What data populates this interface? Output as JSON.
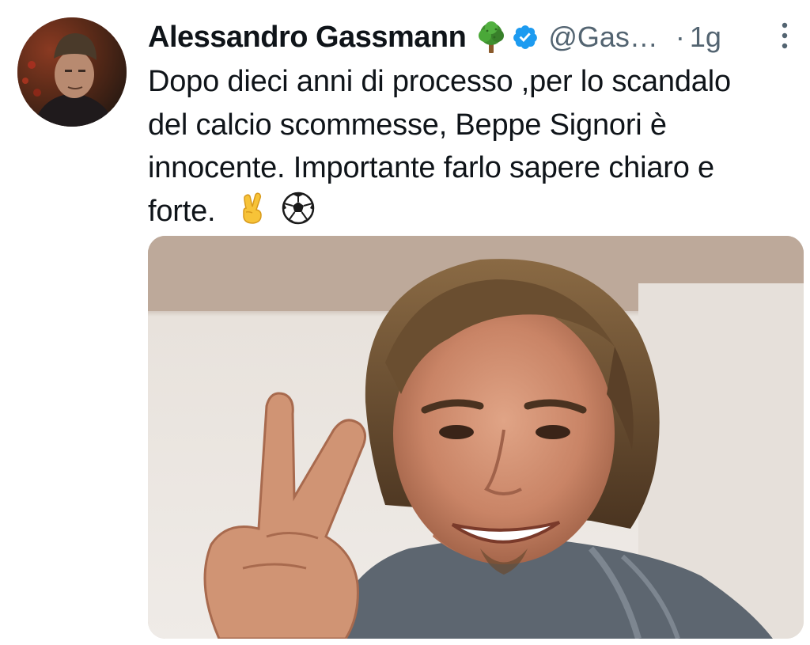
{
  "tweet": {
    "author_name": "Alessandro Gassmann",
    "handle": "@Gas…",
    "separator": "·",
    "time": "1g",
    "text_lines": [
      "Dopo dieci anni di processo ,per lo scandalo",
      "del calcio scommesse, Beppe Signori è",
      "innocente. Importante farlo sapere chiaro e",
      "forte."
    ],
    "emojis": [
      "victory-hand",
      "soccer-ball"
    ],
    "icons": {
      "name_badge": "tree-icon",
      "verified": "verified-badge-icon",
      "menu": "more-vertical-icon"
    }
  },
  "colors": {
    "text": "#0f1419",
    "secondary": "#536471",
    "verified": "#1d9bf0",
    "tree_green": "#3f8f2f"
  }
}
